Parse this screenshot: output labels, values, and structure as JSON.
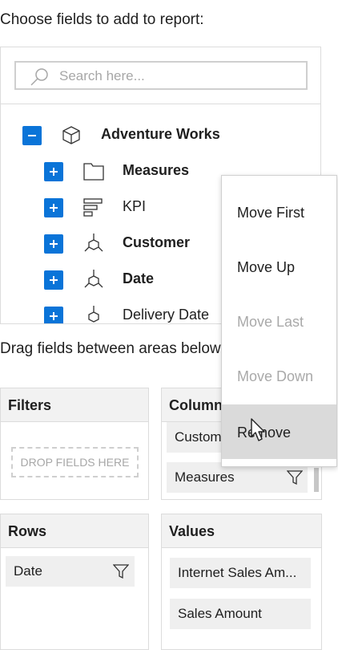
{
  "heading": "Choose fields to add to report:",
  "search": {
    "placeholder": "Search here..."
  },
  "tree": {
    "root": {
      "label": "Adventure Works",
      "icon": "cube-icon"
    },
    "children": [
      {
        "label": "Measures",
        "icon": "folder-icon",
        "bold": true
      },
      {
        "label": "KPI",
        "icon": "kpi-icon",
        "bold": false
      },
      {
        "label": "Customer",
        "icon": "dimension-icon",
        "bold": true
      },
      {
        "label": "Date",
        "icon": "dimension-icon",
        "bold": true
      },
      {
        "label": "Delivery Date",
        "icon": "dimension-icon",
        "bold": false
      }
    ]
  },
  "drag_label": "Drag fields between areas below:",
  "areas": {
    "filters": {
      "title": "Filters",
      "drop_text": "DROP FIELDS HERE"
    },
    "columns": {
      "title": "Columns",
      "items": [
        "Customer",
        "Measures"
      ]
    },
    "rows": {
      "title": "Rows",
      "items": [
        "Date"
      ]
    },
    "values": {
      "title": "Values",
      "items": [
        "Internet Sales Am...",
        "Sales Amount"
      ]
    }
  },
  "context_menu": {
    "items": [
      {
        "label": "Move First",
        "enabled": true
      },
      {
        "label": "Move Up",
        "enabled": true
      },
      {
        "label": "Move Last",
        "enabled": false
      },
      {
        "label": "Move Down",
        "enabled": false
      },
      {
        "label": "Remove",
        "enabled": true,
        "hovered": true
      }
    ]
  },
  "colors": {
    "accent": "#0a74d8",
    "header_bg": "#f2f2f2",
    "chip_bg": "#efefef",
    "menu_hover": "#dadada"
  }
}
